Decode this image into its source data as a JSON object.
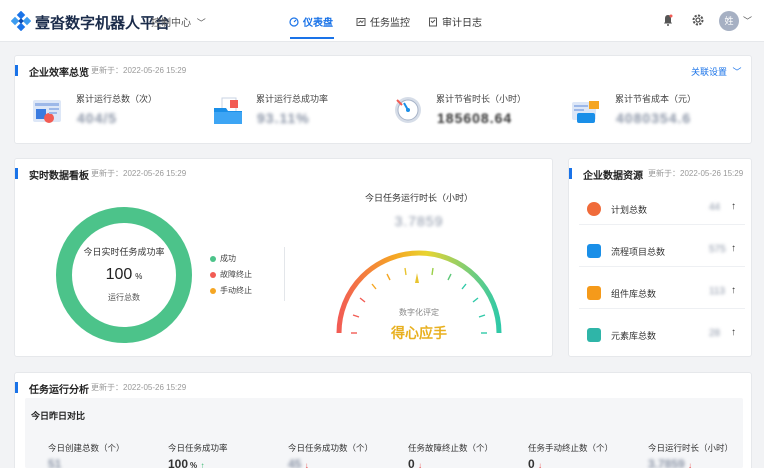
{
  "app": {
    "brand": "壹沓数字机器人平台",
    "control_center": "控制中心"
  },
  "nav": {
    "tabs": [
      {
        "label": "仪表盘",
        "active": true
      },
      {
        "label": "任务监控",
        "active": false
      },
      {
        "label": "审计日志",
        "active": false
      }
    ]
  },
  "user": {
    "avatar_text": "姓"
  },
  "efficiency": {
    "title": "企业效率总览",
    "updated": "更新于：2022-05-26 15:29",
    "link": "关联设置",
    "stats": [
      {
        "label": "累计运行总数（次）",
        "value": "404/5"
      },
      {
        "label": "累计运行总成功率",
        "value": "93.11%"
      },
      {
        "label": "累计节省时长（小时）",
        "value": "185608.64"
      },
      {
        "label": "累计节省成本（元）",
        "value": "4080354.6"
      }
    ]
  },
  "realtime": {
    "title": "实时数据看板",
    "updated": "更新于：2022-05-26 15:29",
    "donut_title": "今日实时任务成功率",
    "donut_value": "100",
    "donut_unit": "%",
    "donut_sub": "运行总数",
    "legend": [
      {
        "label": "成功",
        "color": "#4cc38a"
      },
      {
        "label": "故障终止",
        "color": "#f25c54"
      },
      {
        "label": "手动终止",
        "color": "#f5a623"
      }
    ],
    "gauge_title": "今日任务运行时长（小时）",
    "gauge_value": "3.7859",
    "gauge_caption": "数字化评定",
    "gauge_rating": "得心应手"
  },
  "resources": {
    "title": "企业数据资源",
    "updated": "更新于：2022-05-26 15:29",
    "items": [
      {
        "label": "计划总数",
        "value": "44",
        "icon": "plan-icon",
        "color": "#f06b3a"
      },
      {
        "label": "流程项目总数",
        "value": "575",
        "icon": "flow-icon",
        "color": "#1a8fe8"
      },
      {
        "label": "组件库总数",
        "value": "113",
        "icon": "component-icon",
        "color": "#f59a1a"
      },
      {
        "label": "元素库总数",
        "value": "28",
        "icon": "element-icon",
        "color": "#2fb5a8"
      }
    ]
  },
  "analysis": {
    "title": "任务运行分析",
    "updated": "更新于：2022-05-26 15:29",
    "compare_title": "今日昨日对比",
    "items": [
      {
        "label": "今日创建总数（个）",
        "value": "51",
        "trend": "",
        "blur": true
      },
      {
        "label": "今日任务成功率",
        "value": "100",
        "unit": "%",
        "trend": "↑",
        "blur": false
      },
      {
        "label": "今日任务成功数（个）",
        "value": "45",
        "trend": "↓",
        "blur": true
      },
      {
        "label": "任务故障终止数（个）",
        "value": "0",
        "trend": "↓",
        "blur": false
      },
      {
        "label": "任务手动终止数（个）",
        "value": "0",
        "trend": "↓",
        "blur": false
      },
      {
        "label": "今日运行时长（小时）",
        "value": "3.7859",
        "trend": "↓",
        "blur": true
      }
    ]
  }
}
